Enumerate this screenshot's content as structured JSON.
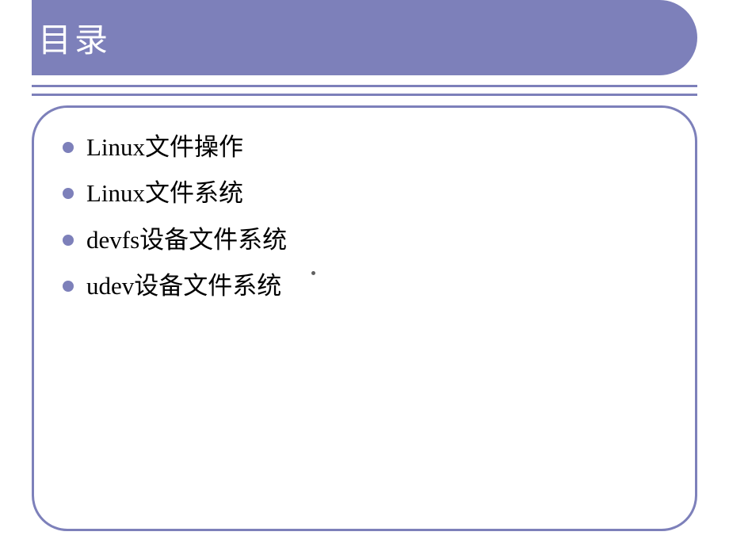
{
  "header": {
    "title": "目录"
  },
  "content": {
    "bullets": [
      "Linux文件操作",
      "Linux文件系统",
      "devfs设备文件系统",
      "udev设备文件系统"
    ]
  },
  "colors": {
    "accent": "#7d80ba",
    "text": "#000000",
    "title": "#ffffff"
  }
}
